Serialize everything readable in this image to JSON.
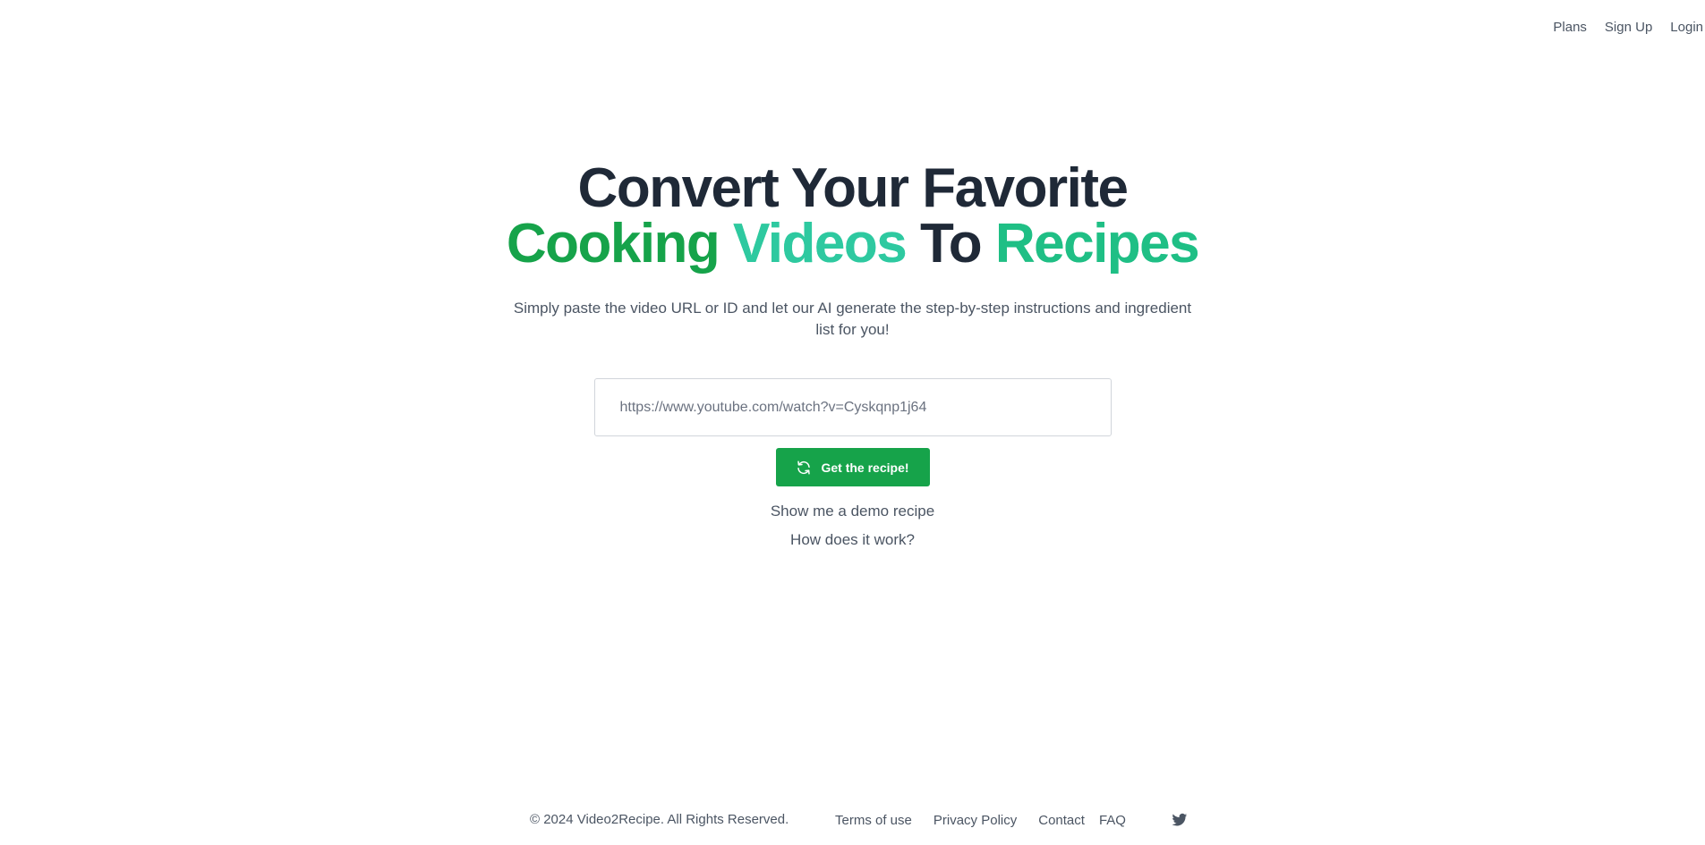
{
  "nav": {
    "plans": "Plans",
    "signup": "Sign Up",
    "login": "Login"
  },
  "hero": {
    "line1": "Convert Your Favorite",
    "word_cooking": "Cooking",
    "word_videos": "Videos",
    "word_to": "To",
    "word_recipes": "Recipes",
    "subtitle": "Simply paste the video URL or ID and let our AI generate the step-by-step instructions and ingredient list for you!",
    "input_placeholder": "https://www.youtube.com/watch?v=Cyskqnp1j64",
    "button_label": "Get the recipe!",
    "demo_link": "Show me a demo recipe",
    "how_link": "How does it work?"
  },
  "footer": {
    "copyright": "© 2024 Video2Recipe. All Rights Reserved.",
    "links": [
      "Terms of use",
      "Privacy Policy",
      "Contact",
      "FAQ"
    ],
    "social_icon": "twitter-icon"
  },
  "colors": {
    "accent_green": "#16a34a",
    "accent_teal": "#2dd4bf",
    "text_dark": "#1f2937",
    "text_muted": "#4b5563"
  }
}
